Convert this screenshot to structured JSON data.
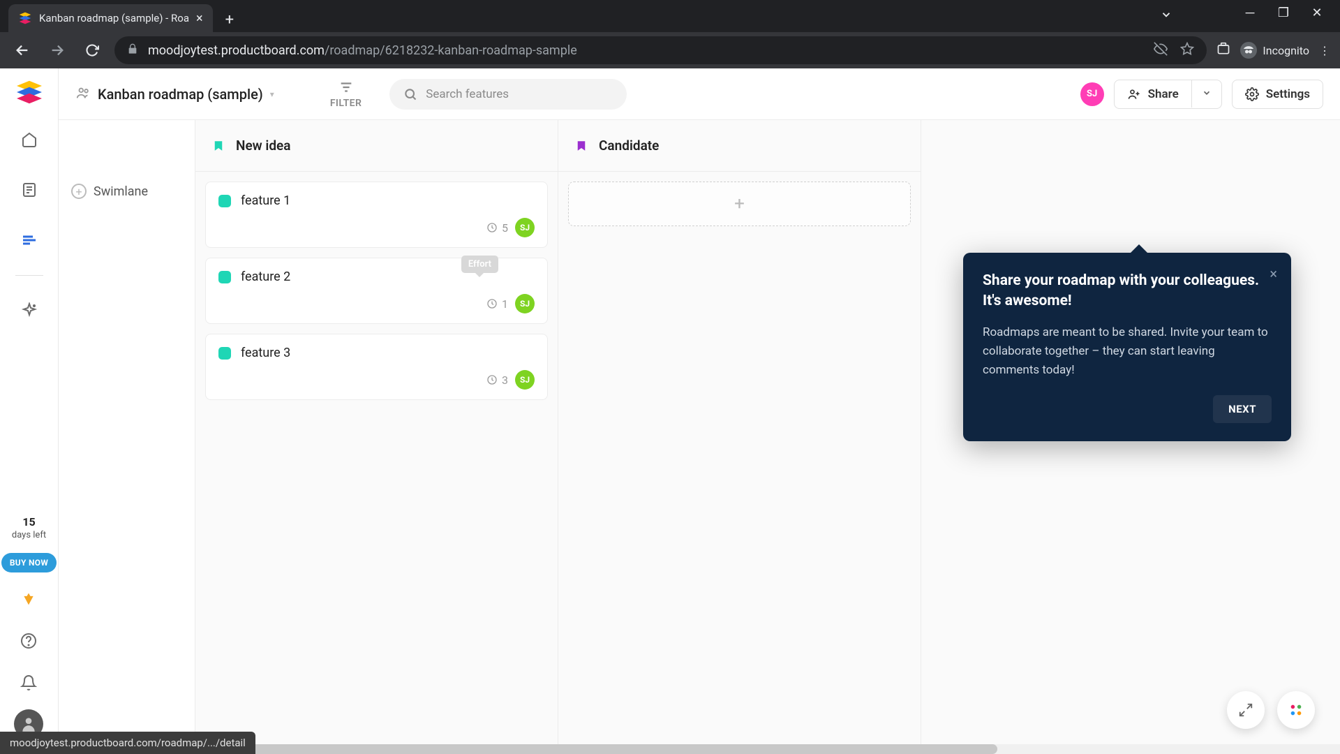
{
  "browser": {
    "tab_title": "Kanban roadmap (sample) - Roa",
    "url_domain": "moodjoytest.productboard.com",
    "url_path": "/roadmap/6218232-kanban-roadmap-sample",
    "incognito_label": "Incognito"
  },
  "leftbar": {
    "days_number": "15",
    "days_label": "days left",
    "buy_now": "BUY NOW"
  },
  "topbar": {
    "board_title": "Kanban roadmap (sample)",
    "filter_label": "FILTER",
    "search_placeholder": "Search features",
    "avatar_initials": "SJ",
    "share_label": "Share",
    "settings_label": "Settings"
  },
  "swimlane": {
    "label": "Swimlane"
  },
  "columns": [
    {
      "title": "New idea",
      "bookmark_color": "#1fd6b5",
      "cards": [
        {
          "title": "feature 1",
          "effort": "5",
          "assignee": "SJ"
        },
        {
          "title": "feature 2",
          "effort": "1",
          "assignee": "SJ",
          "tooltip": "Effort"
        },
        {
          "title": "feature 3",
          "effort": "3",
          "assignee": "SJ"
        }
      ]
    },
    {
      "title": "Candidate",
      "bookmark_color": "#9b2fcf",
      "cards": []
    }
  ],
  "popover": {
    "title": "Share your roadmap with your colleagues. It's awesome!",
    "body": "Roadmaps are meant to be shared. Invite your team to collaborate together – they can start leaving comments today!",
    "next": "NEXT"
  },
  "status_bar": "moodjoytest.productboard.com/roadmap/.../detail"
}
